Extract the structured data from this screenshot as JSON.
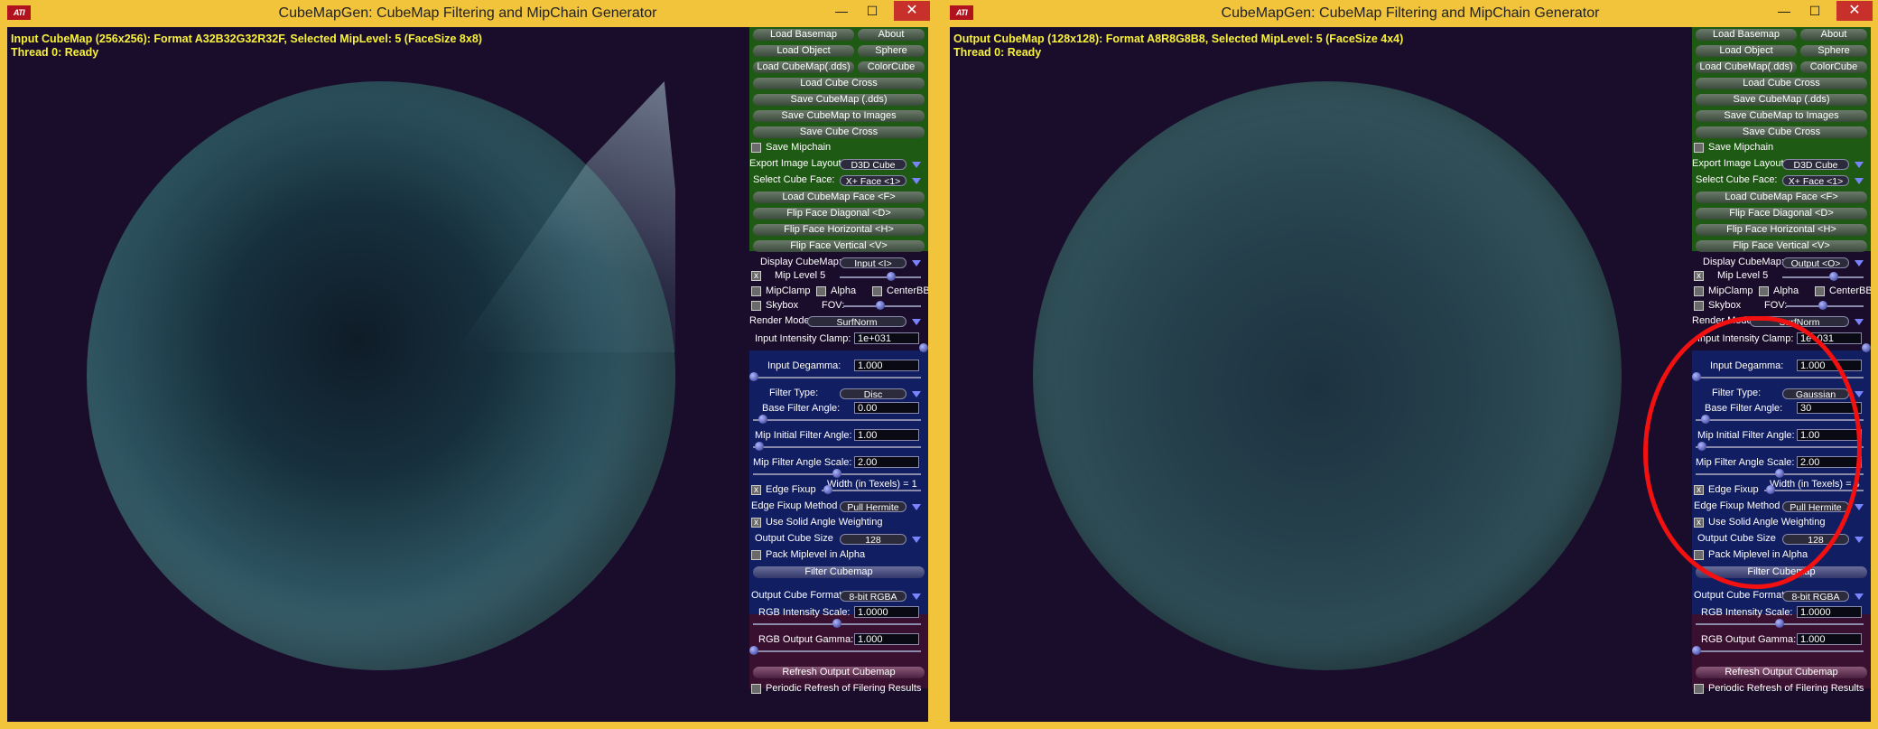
{
  "windows": [
    {
      "id": "left",
      "title": "CubeMapGen: CubeMap Filtering and MipChain Generator",
      "logo": "ATI",
      "status_line1": "Input CubeMap (256x256): Format A32B32G32R32F, Selected MipLevel: 5 (FaceSize 8x8)",
      "status_line2": "Thread 0: Ready",
      "display_cubemap": "Input <I>",
      "filter_type": "Disc",
      "base_filter_angle": "0.00",
      "width_texels": "Width (in Texels) = 1"
    },
    {
      "id": "right",
      "title": "CubeMapGen: CubeMap Filtering and MipChain Generator",
      "logo": "ATI",
      "status_line1": "Output CubeMap (128x128): Format A8R8G8B8, Selected MipLevel: 5 (FaceSize 4x4)",
      "status_line2": "Thread 0: Ready",
      "display_cubemap": "Output <O>",
      "filter_type": "Gaussian",
      "base_filter_angle": "30",
      "width_texels": "Width (in Texels) = 4"
    }
  ],
  "window_controls": {
    "minimize": "—",
    "maximize": "☐",
    "close": "✕"
  },
  "panel": {
    "load_basemap": "Load Basemap",
    "about": "About",
    "load_object": "Load Object",
    "sphere": "Sphere",
    "load_cubemap_dds": "Load CubeMap(.dds)",
    "colorcube": "ColorCube",
    "load_cube_cross": "Load Cube Cross",
    "save_cubemap_dds": "Save CubeMap (.dds)",
    "save_cubemap_images": "Save CubeMap to Images",
    "save_cube_cross": "Save Cube Cross",
    "save_mipchain": "Save Mipchain",
    "export_image_layout_label": "Export Image Layout:",
    "export_image_layout_value": "D3D Cube",
    "select_cube_face_label": "Select Cube Face:",
    "select_cube_face_value": "X+ Face <1>",
    "load_cubemap_face": "Load CubeMap Face  <F>",
    "flip_face_diagonal": "Flip Face Diagonal   <D>",
    "flip_face_horizontal": "Flip Face Horizontal   <H>",
    "flip_face_vertical": "Flip Face Vertical   <V>",
    "display_cubemap_label": "Display CubeMap:",
    "mip_level_label": "Mip Level  5",
    "mipclamp": "MipClamp",
    "alpha": "Alpha",
    "centerbb": "CenterBB",
    "skybox": "Skybox",
    "fov": "FOV:",
    "render_mode_label": "Render Mode",
    "render_mode_value": "SurfNorm",
    "input_intensity_clamp_label": "Input Intensity Clamp:",
    "input_intensity_clamp_value": "1e+031",
    "input_degamma_label": "Input Degamma:",
    "input_degamma_value": "1.000",
    "filter_type_label": "Filter Type:",
    "base_filter_angle_label": "Base Filter Angle:",
    "mip_initial_filter_angle_label": "Mip Initial Filter Angle:",
    "mip_initial_filter_angle_value": "1.00",
    "mip_filter_angle_scale_label": "Mip Filter Angle Scale:",
    "mip_filter_angle_scale_value": "2.00",
    "edge_fixup": "Edge Fixup",
    "edge_fixup_method_label": "Edge Fixup Method",
    "edge_fixup_method_value": "Pull Hermite",
    "use_solid_angle_weighting": "Use Solid Angle Weighting",
    "output_cube_size_label": "Output Cube Size",
    "output_cube_size_value": "128",
    "pack_miplevel_in_alpha": "Pack Miplevel in Alpha",
    "filter_cubemap": "Filter Cubemap",
    "output_cube_format_label": "Output Cube Format",
    "output_cube_format_value": "8-bit RGBA",
    "rgb_intensity_scale_label": "RGB Intensity Scale:",
    "rgb_intensity_scale_value": "1.0000",
    "rgb_output_gamma_label": "RGB Output Gamma:",
    "rgb_output_gamma_value": "1.000",
    "refresh_output_cubemap": "Refresh Output Cubemap",
    "periodic_refresh": "Periodic Refresh of Filering Results"
  },
  "colors": {
    "title_bar": "#f2c43c",
    "status_text": "#f8f23a",
    "annotation": "#f21010"
  }
}
